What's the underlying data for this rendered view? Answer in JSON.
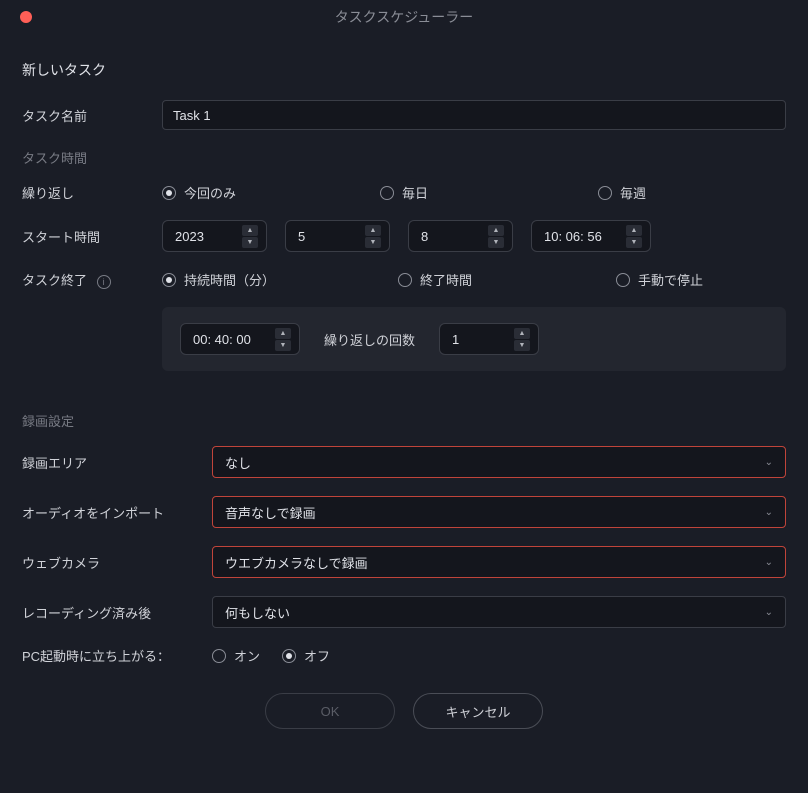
{
  "window": {
    "title": "タスクスケジューラー"
  },
  "header": {
    "new_task": "新しいタスク"
  },
  "task_name": {
    "label": "タスク名前",
    "value": "Task 1"
  },
  "task_time": {
    "group_label": "タスク時間",
    "repeat": {
      "label": "繰り返し",
      "options": {
        "once": "今回のみ",
        "daily": "毎日",
        "weekly": "毎週"
      },
      "selected": "once"
    },
    "start": {
      "label": "スタート時間",
      "year": "2023",
      "month": "5",
      "day": "8",
      "time": "10: 06: 56"
    },
    "end": {
      "label": "タスク終了",
      "options": {
        "duration": "持続時間（分）",
        "end_time": "終了時間",
        "manual": "手動で停止"
      },
      "selected": "duration",
      "duration_value": "00: 40: 00",
      "repeat_count_label": "繰り返しの回数",
      "repeat_count_value": "1"
    }
  },
  "record": {
    "group_label": "録画設定",
    "area": {
      "label": "録画エリア",
      "value": "なし"
    },
    "audio": {
      "label": "オーディオをインポート",
      "value": "音声なしで録画"
    },
    "webcam": {
      "label": "ウェブカメラ",
      "value": "ウエブカメラなしで録画"
    },
    "after": {
      "label": "レコーディング済み後",
      "value": "何もしない"
    },
    "startup": {
      "label": "PC起動時に立ち上がる：",
      "on": "オン",
      "off": "オフ",
      "selected": "off"
    }
  },
  "buttons": {
    "ok": "OK",
    "cancel": "キャンセル"
  }
}
